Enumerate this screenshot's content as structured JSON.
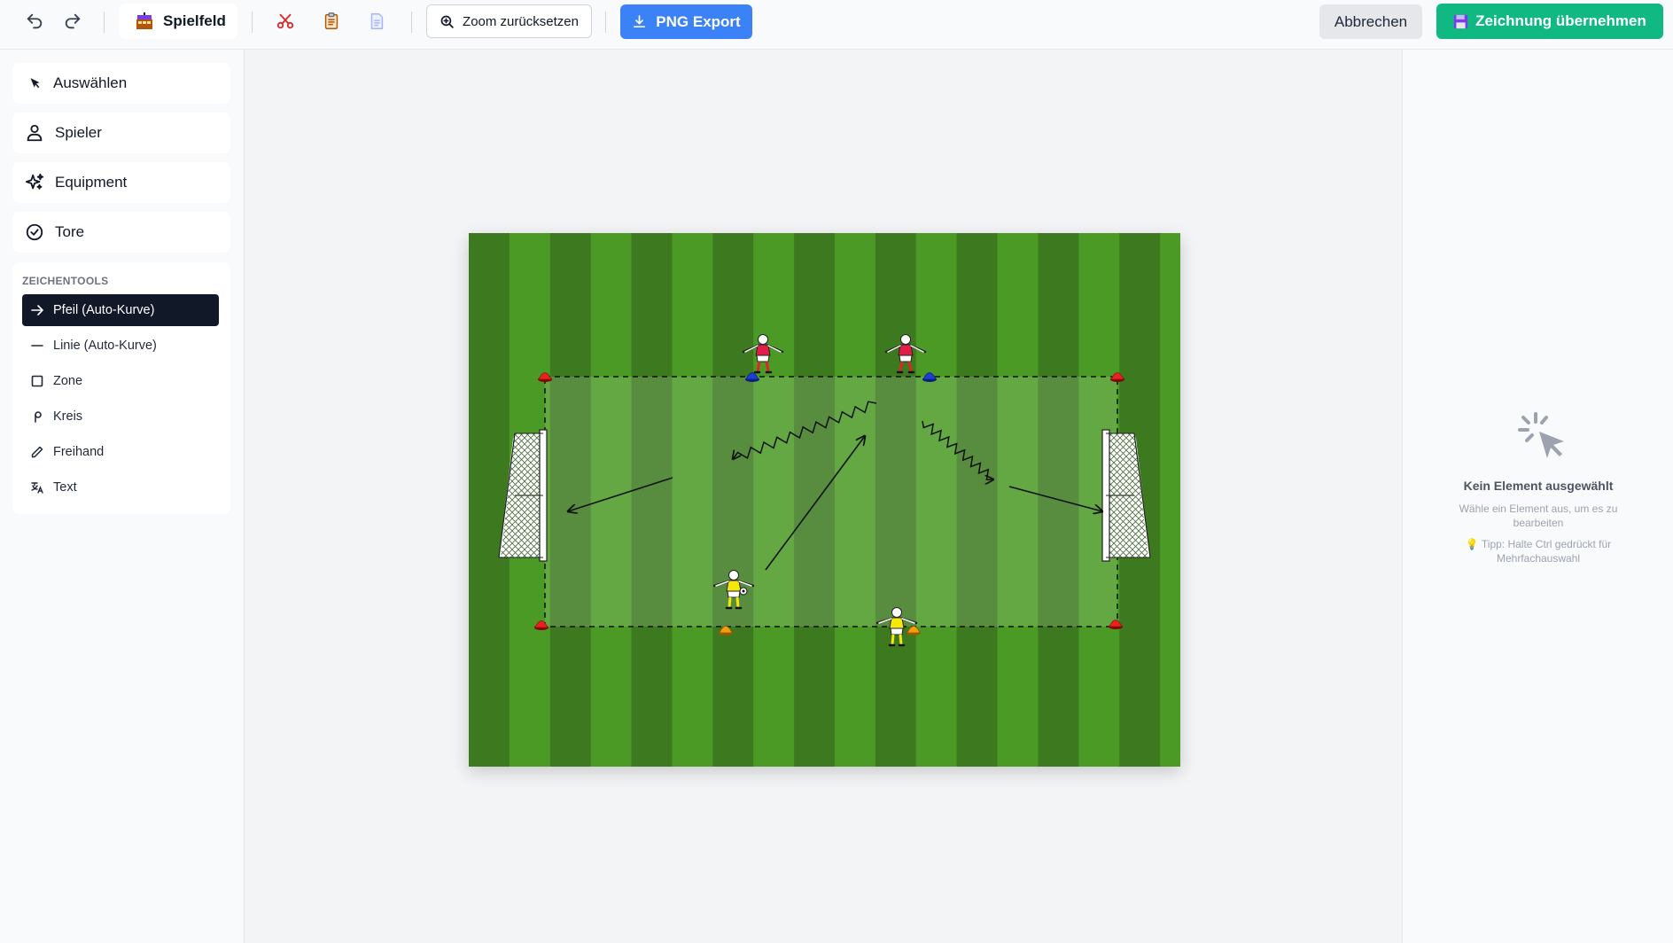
{
  "toolbar": {
    "field_label": "Spielfeld",
    "zoom_reset_label": "Zoom zurücksetzen",
    "png_export_label": "PNG Export",
    "cancel_label": "Abbrechen",
    "accept_label": "Zeichnung übernehmen",
    "icons": [
      "undo-icon",
      "redo-icon",
      "field-icon",
      "cut-icon",
      "clipboard-icon",
      "document-icon",
      "zoom-icon",
      "download-icon",
      "save-icon"
    ]
  },
  "sidebar": {
    "items": [
      {
        "label": "Auswählen",
        "icon": "cursor-icon"
      },
      {
        "label": "Spieler",
        "icon": "person-icon"
      },
      {
        "label": "Equipment",
        "icon": "sparkles-icon"
      },
      {
        "label": "Tore",
        "icon": "check-circle-icon"
      }
    ],
    "tools_title": "ZEICHENTOOLS",
    "tools": [
      {
        "label": "Pfeil (Auto-Kurve)",
        "icon": "arrow-right-icon",
        "active": true
      },
      {
        "label": "Linie (Auto-Kurve)",
        "icon": "line-icon",
        "active": false
      },
      {
        "label": "Zone",
        "icon": "square-icon",
        "active": false
      },
      {
        "label": "Kreis",
        "icon": "circle-icon",
        "active": false
      },
      {
        "label": "Freihand",
        "icon": "pencil-icon",
        "active": false
      },
      {
        "label": "Text",
        "icon": "text-icon",
        "active": false
      }
    ]
  },
  "right_panel": {
    "title": "Kein Element ausgewählt",
    "subtitle": "Wähle ein Element aus, um es zu bearbeiten",
    "tip": "💡 Tipp: Halte Ctrl gedrückt für Mehrfachauswahl"
  },
  "colors": {
    "accent_blue": "#3b82f6",
    "accent_green": "#10b981",
    "active_tool": "#111827",
    "pitch_dark": "#3d7a1f",
    "pitch_light": "#4a9a25",
    "red_team": "#dc2626",
    "yellow_team": "#f5e70a",
    "cone_red": "#ef1f1f",
    "cone_blue": "#1d3fd6",
    "cone_orange": "#f59e0b"
  }
}
